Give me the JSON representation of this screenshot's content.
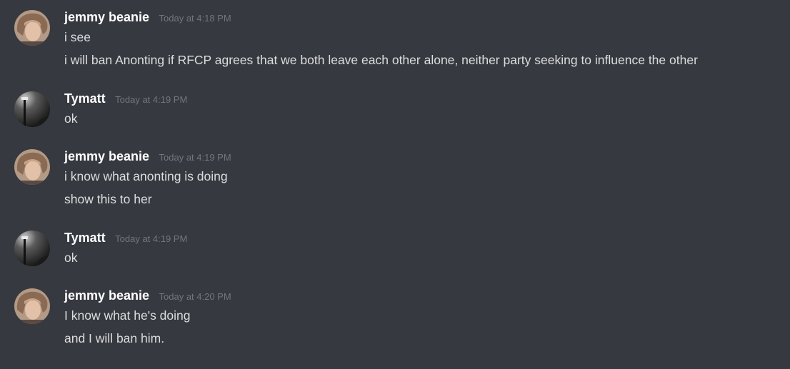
{
  "messages": [
    {
      "author": "jemmy beanie",
      "avatar_icon": "portrait-avatar",
      "timestamp": "Today at 4:18 PM",
      "lines": [
        "i see",
        "i will ban Anonting if RFCP agrees that we both leave each other alone, neither party seeking to influence the other"
      ]
    },
    {
      "author": "Tymatt",
      "avatar_icon": "lamp-post-avatar",
      "timestamp": "Today at 4:19 PM",
      "lines": [
        "ok"
      ]
    },
    {
      "author": "jemmy beanie",
      "avatar_icon": "portrait-avatar",
      "timestamp": "Today at 4:19 PM",
      "lines": [
        "i know what anonting is doing",
        "show this to her"
      ]
    },
    {
      "author": "Tymatt",
      "avatar_icon": "lamp-post-avatar",
      "timestamp": "Today at 4:19 PM",
      "lines": [
        "ok"
      ]
    },
    {
      "author": "jemmy beanie",
      "avatar_icon": "portrait-avatar",
      "timestamp": "Today at 4:20 PM",
      "lines": [
        "I know what he's  doing",
        "and I will ban him."
      ]
    }
  ],
  "colors": {
    "background": "#36393f",
    "username": "#ffffff",
    "timestamp": "#72767d",
    "message_text": "#dcddde"
  }
}
